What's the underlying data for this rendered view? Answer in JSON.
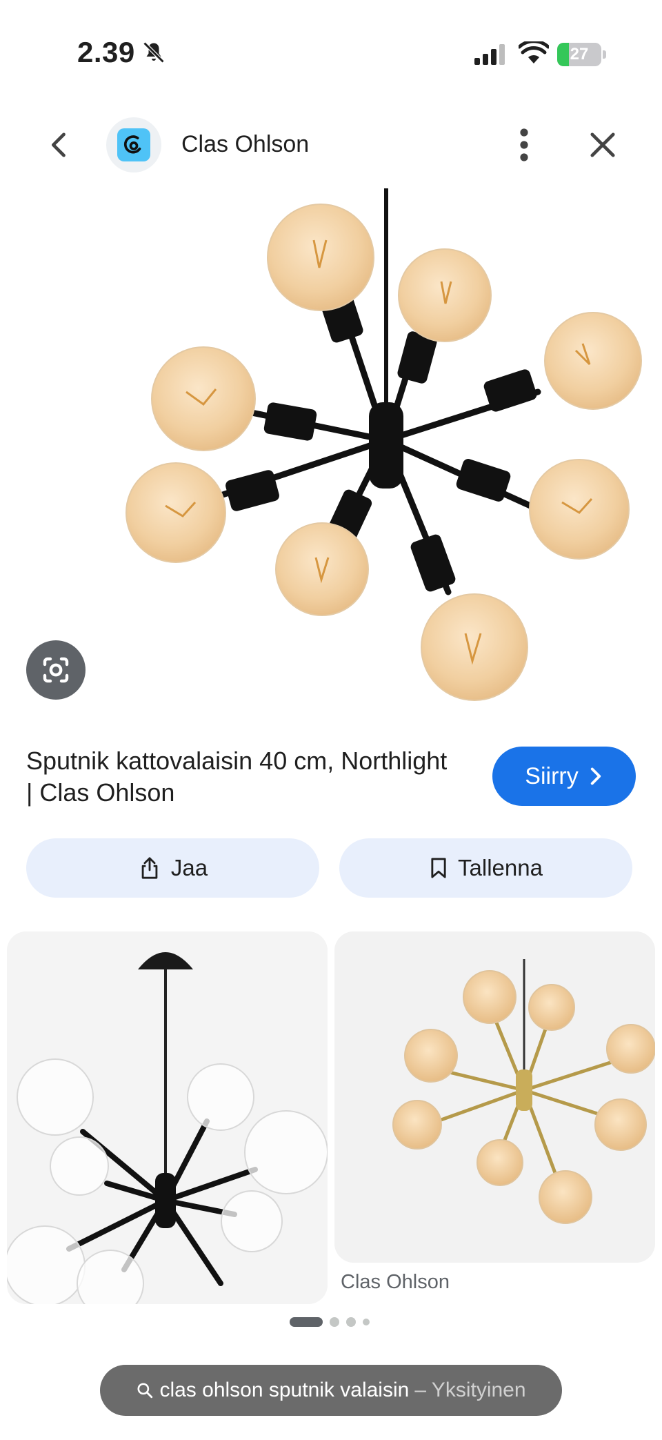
{
  "status_bar": {
    "time": "2.39",
    "battery_level": "27",
    "icons": [
      "bell-slash-icon",
      "signal-icon",
      "wifi-icon",
      "battery-charging-icon"
    ]
  },
  "header": {
    "site_name": "Clas Ohlson",
    "icons": [
      "back-arrow-icon",
      "site-logo-icon",
      "more-vert-icon",
      "close-icon"
    ]
  },
  "result": {
    "title": "Sputnik kattovalaisin 40 cm, Northlight | Clas Ohlson",
    "visit_label": "Siirry",
    "share_label": "Jaa",
    "save_label": "Tallenna"
  },
  "related": {
    "items": [
      {
        "source": ""
      },
      {
        "source": "Clas Ohlson"
      }
    ]
  },
  "pager": {
    "count": 4,
    "active": 0
  },
  "search": {
    "query": "clas ohlson sputnik valaisin",
    "mode": "– Yksityinen"
  },
  "colors": {
    "accent": "#1a73e8",
    "action_bg": "#e8effc",
    "pill_bg": "#6b6b6b",
    "battery": "#34c759"
  }
}
